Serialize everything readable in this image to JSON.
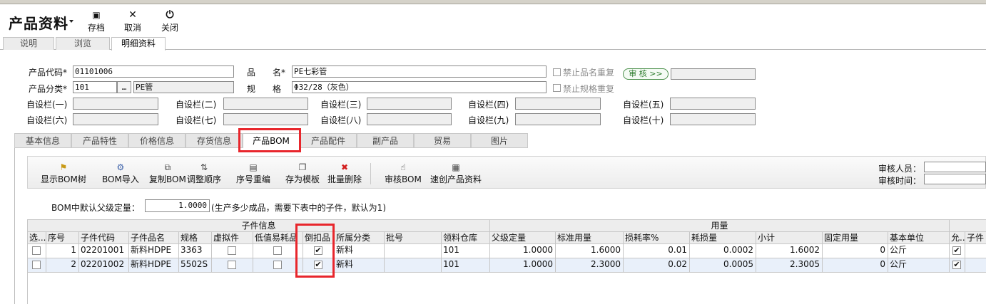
{
  "header": {
    "title": "产品资料",
    "toolbar": [
      {
        "label": "存档",
        "icon": "save-icon",
        "glyph": "💾"
      },
      {
        "label": "取消",
        "icon": "cancel-icon",
        "glyph": "✕"
      },
      {
        "label": "关闭",
        "icon": "power-icon",
        "glyph": "⏻"
      }
    ]
  },
  "top_tabs": [
    "说明",
    "浏览",
    "明细资料"
  ],
  "form": {
    "product_code_label": "产品代码*",
    "product_code": "01101006",
    "product_name_label": "品　　名*",
    "product_name": "PE七彩管",
    "category_label": "产品分类*",
    "category_code": "101",
    "category_name": "PE管",
    "spec_label": "规　　格",
    "spec": "Φ32/28（灰色）",
    "no_dup_name": "禁止品名重复",
    "no_dup_spec": "禁止规格重复",
    "audit_button": "审 核 >>",
    "custom_fields": [
      "自设栏(一)",
      "自设栏(二)",
      "自设栏(三)",
      "自设栏(四)",
      "自设栏(五)",
      "自设栏(六)",
      "自设栏(七)",
      "自设栏(八)",
      "自设栏(九)",
      "自设栏(十)"
    ]
  },
  "sub_tabs": [
    "基本信息",
    "产品特性",
    "价格信息",
    "存货信息",
    "产品BOM",
    "产品配件",
    "副产品",
    "贸易",
    "图片"
  ],
  "bom_toolbar": {
    "buttons": [
      "显示BOM树",
      "BOM导入",
      "复制BOM",
      "调整顺序",
      "序号重编",
      "存为模板",
      "批量删除",
      "审核BOM",
      "速创产品资料"
    ],
    "reviewer_label": "审核人员：",
    "review_time_label": "审核时间："
  },
  "bom_default": {
    "label": "BOM中默认父级定量：",
    "value": "1.0000",
    "hint": "(生产多少成品，需要下表中的子件，默认为1)"
  },
  "grid": {
    "group_child": "子件信息",
    "group_usage": "用量",
    "columns": [
      "选...",
      "序号",
      "子件代码",
      "子件品名",
      "规格",
      "虚拟件",
      "低值易耗品",
      "倒扣品",
      "所属分类",
      "批号",
      "领料仓库",
      "父级定量",
      "标准用量",
      "损耗率%",
      "耗损量",
      "小计",
      "固定用量",
      "基本单位",
      "允...",
      "子件"
    ],
    "rows": [
      {
        "seq": "1",
        "code": "02201001",
        "name": "新料HDPE",
        "spec": "3363",
        "category": "新料",
        "warehouse": "101",
        "parent_qty": "1.0000",
        "std_qty": "1.6000",
        "loss_rate": "0.01",
        "loss_qty": "0.0002",
        "subtotal": "1.6002",
        "fixed_qty": "0",
        "unit": "公斤"
      },
      {
        "seq": "2",
        "code": "02201002",
        "name": "新料HDPE",
        "spec": "5502S",
        "category": "新料",
        "warehouse": "101",
        "parent_qty": "1.0000",
        "std_qty": "2.3000",
        "loss_rate": "0.02",
        "loss_qty": "0.0005",
        "subtotal": "2.3005",
        "fixed_qty": "0",
        "unit": "公斤"
      }
    ],
    "check_glyph": "✔"
  },
  "colors": {
    "highlight": "#e8262c",
    "selected_row": "#e9f0fa",
    "header_bg": "#ededed"
  }
}
